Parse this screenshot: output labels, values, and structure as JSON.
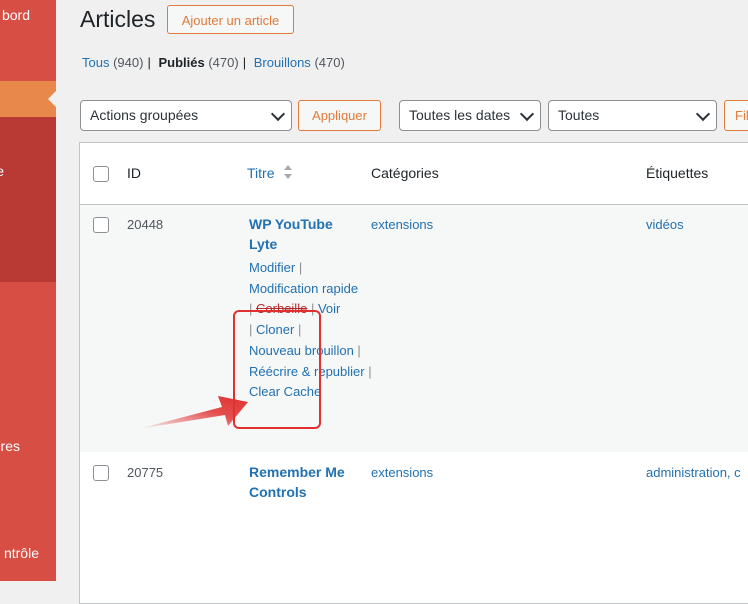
{
  "sidebar": {
    "items": [
      {
        "label": "bord"
      },
      {
        "label": "e"
      },
      {
        "label": "res"
      },
      {
        "label": "ntrôle"
      }
    ]
  },
  "header": {
    "title": "Articles",
    "add_button": "Ajouter un article"
  },
  "views": [
    {
      "label": "Tous",
      "count": "(940)"
    },
    {
      "label": "Publiés",
      "count": "(470)"
    },
    {
      "label": "Brouillons",
      "count": "(470)"
    }
  ],
  "filters": {
    "bulk_actions": "Actions groupées",
    "apply": "Appliquer",
    "dates": "Toutes les dates",
    "categories": "Toutes",
    "filter": "Fil"
  },
  "table": {
    "columns": {
      "id": "ID",
      "title": "Titre",
      "categories": "Catégories",
      "tags": "Étiquettes"
    },
    "rows": [
      {
        "id": "20448",
        "title_line1": "WP YouTube",
        "title_line2": "Lyte",
        "category": "extensions",
        "tags": "vidéos",
        "actions": {
          "edit": "Modifier",
          "quick_edit": "Modification rapide",
          "trash": "Corbeille",
          "view": "Voir",
          "clone": "Cloner",
          "new_draft": "Nouveau brouillon",
          "rewrite": "Réécrire & republier",
          "clear_cache": "Clear Cache"
        }
      },
      {
        "id": "20775",
        "title_line1": "Remember Me",
        "title_line2": "Controls",
        "category": "extensions",
        "tags": "administration, c"
      }
    ]
  },
  "colors": {
    "sidebar": "#d64e44",
    "sidebar_current": "#e8884a",
    "accent_button": "#e07b3a",
    "link": "#2271b1",
    "annotation": "#e03030"
  }
}
